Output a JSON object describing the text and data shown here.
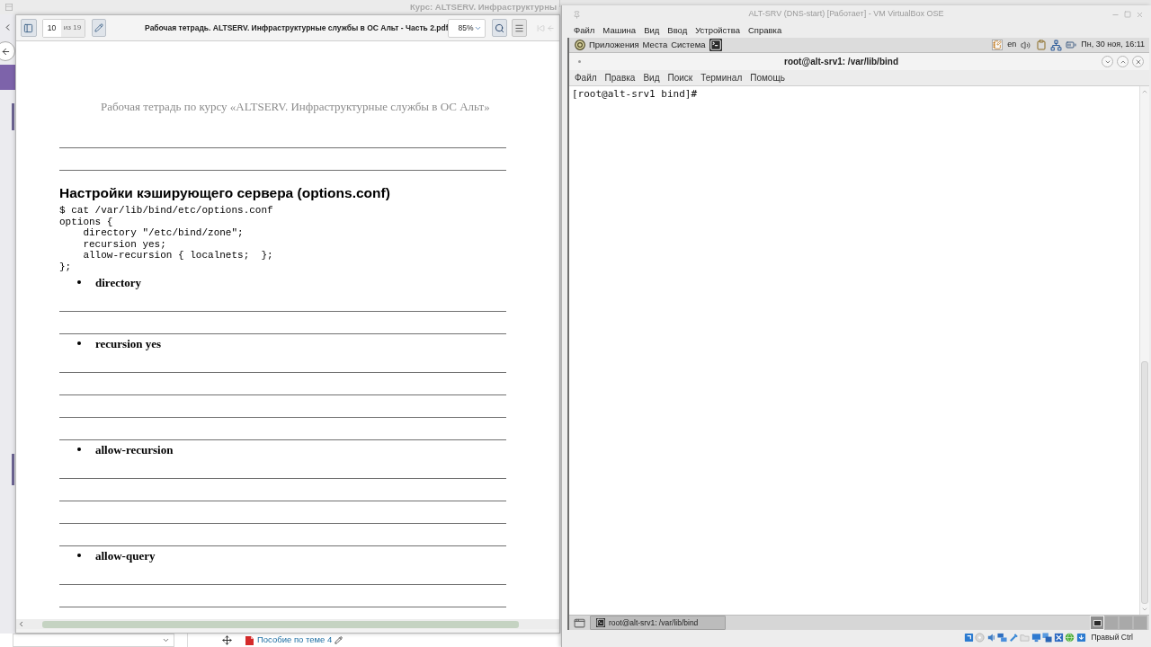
{
  "browser": {
    "title": "Курс: ALTSERV. Инфраструктурны",
    "link": "Пособие по теме 4"
  },
  "pdf_viewer": {
    "page_number": "10",
    "page_count": "из 19",
    "file_title": "Рабочая тетрадь. ALTSERV. Инфраструктурные службы в ОС Альт - Часть 2.pdf",
    "zoom": "85%",
    "page": {
      "running_header": "Рабочая тетрадь по курсу «ALTSERV. Инфраструктурные службы в ОС Альт»",
      "blocks": [
        {
          "kind": "rule"
        },
        {
          "kind": "rule"
        },
        {
          "kind": "heading",
          "text": "Настройки кэширующего сервера (options.conf)"
        },
        {
          "kind": "code",
          "lines": [
            "$ cat /var/lib/bind/etc/options.conf",
            "options {",
            "    directory \"/etc/bind/zone\";",
            "    recursion yes;",
            "    allow-recursion { localnets;  };",
            "};"
          ]
        },
        {
          "kind": "bullet",
          "text": "directory"
        },
        {
          "kind": "rule"
        },
        {
          "kind": "rule"
        },
        {
          "kind": "bullet",
          "text": "recursion yes"
        },
        {
          "kind": "rule"
        },
        {
          "kind": "rule"
        },
        {
          "kind": "rule"
        },
        {
          "kind": "rule"
        },
        {
          "kind": "bullet",
          "text": "allow-recursion"
        },
        {
          "kind": "rule"
        },
        {
          "kind": "rule"
        },
        {
          "kind": "rule"
        },
        {
          "kind": "rule"
        },
        {
          "kind": "bullet",
          "text": "allow-query"
        },
        {
          "kind": "rule"
        },
        {
          "kind": "rule"
        }
      ]
    }
  },
  "vm_window": {
    "title": "ALT-SRV (DNS-start) [Работает] - VM VirtualBox OSE",
    "menu": [
      "Файл",
      "Машина",
      "Вид",
      "Ввод",
      "Устройства",
      "Справка"
    ],
    "guest_panel": {
      "menus": [
        "Приложения",
        "Места",
        "Система"
      ],
      "keyboard_layout": "en",
      "clock": "Пн, 30 ноя, 16:11"
    },
    "terminal": {
      "title": "root@alt-srv1: /var/lib/bind",
      "menu": [
        "Файл",
        "Правка",
        "Вид",
        "Поиск",
        "Терминал",
        "Помощь"
      ],
      "lines": [
        "[root@alt-srv1 bind]#"
      ]
    },
    "taskbar": {
      "tasks": [
        {
          "label": "root@alt-srv1: /var/lib/bind",
          "selected": true
        }
      ],
      "workspaces": [
        {
          "selected": true
        },
        {
          "selected": false
        },
        {
          "selected": false
        },
        {
          "selected": false
        }
      ]
    },
    "status_bar": {
      "host_key": "Правый Ctrl"
    }
  }
}
